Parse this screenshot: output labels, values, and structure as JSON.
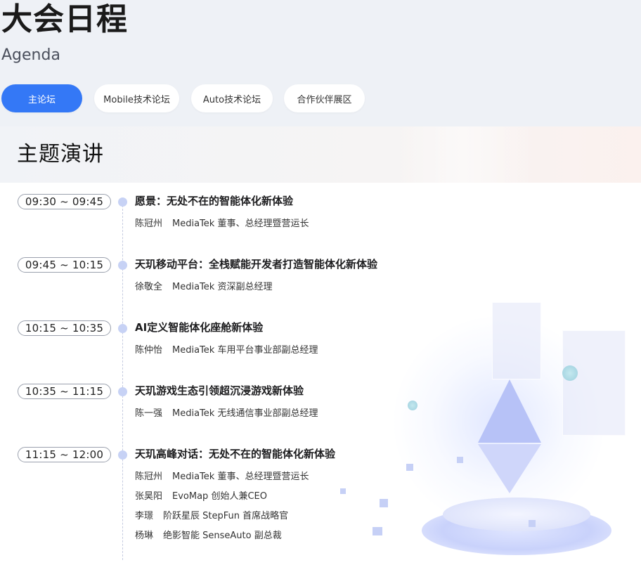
{
  "header": {
    "title": "大会日程",
    "subtitle": "Agenda"
  },
  "tabs": [
    {
      "label": "主论坛",
      "active": true
    },
    {
      "label": "Mobile技术论坛",
      "active": false
    },
    {
      "label": "Auto技术论坛",
      "active": false
    },
    {
      "label": "合作伙伴展区",
      "active": false
    }
  ],
  "section": {
    "title": "主题演讲"
  },
  "agenda": [
    {
      "time": "09:30 ~ 09:45",
      "title": "愿景：无处不在的智能体化新体验",
      "speakers": [
        {
          "name": "陈冠州",
          "role": "MediaTek 董事、总经理暨营运长"
        }
      ]
    },
    {
      "time": "09:45 ~ 10:15",
      "title": "天玑移动平台：全栈赋能开发者打造智能体化新体验",
      "speakers": [
        {
          "name": "徐敬全",
          "role": "MediaTek 资深副总经理"
        }
      ]
    },
    {
      "time": "10:15 ~ 10:35",
      "title": "AI定义智能体化座舱新体验",
      "speakers": [
        {
          "name": "陈仲怡",
          "role": "MediaTek 车用平台事业部副总经理"
        }
      ]
    },
    {
      "time": "10:35 ~ 11:15",
      "title": "天玑游戏生态引领超沉浸游戏新体验",
      "speakers": [
        {
          "name": "陈一强",
          "role": "MediaTek 无线通信事业部副总经理"
        }
      ]
    },
    {
      "time": "11:15 ~ 12:00",
      "title": "天玑高峰对话：无处不在的智能体化新体验",
      "speakers": [
        {
          "name": "陈冠州",
          "role": "MediaTek 董事、总经理暨营运长"
        },
        {
          "name": "张昊阳",
          "role": "EvoMap 创始人兼CEO"
        },
        {
          "name": "李璟",
          "role": "阶跃星辰 StepFun 首席战略官"
        },
        {
          "name": "杨琳",
          "role": "绝影智能 SenseAuto 副总裁"
        }
      ]
    }
  ],
  "colors": {
    "accent": "#3478f6",
    "dot": "#c7d2f5"
  }
}
